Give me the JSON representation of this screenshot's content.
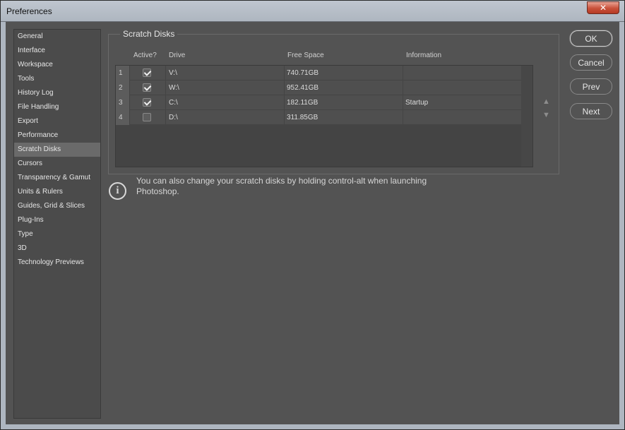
{
  "window": {
    "title": "Preferences",
    "close_label": "✕"
  },
  "sidebar": {
    "items": [
      {
        "label": "General"
      },
      {
        "label": "Interface"
      },
      {
        "label": "Workspace"
      },
      {
        "label": "Tools"
      },
      {
        "label": "History Log"
      },
      {
        "label": "File Handling"
      },
      {
        "label": "Export"
      },
      {
        "label": "Performance"
      },
      {
        "label": "Scratch Disks"
      },
      {
        "label": "Cursors"
      },
      {
        "label": "Transparency & Gamut"
      },
      {
        "label": "Units & Rulers"
      },
      {
        "label": "Guides, Grid & Slices"
      },
      {
        "label": "Plug-Ins"
      },
      {
        "label": "Type"
      },
      {
        "label": "3D"
      },
      {
        "label": "Technology Previews"
      }
    ],
    "selected": "Scratch Disks"
  },
  "scratch": {
    "group_title": "Scratch Disks",
    "columns": {
      "active": "Active?",
      "drive": "Drive",
      "free": "Free Space",
      "info": "Information"
    },
    "rows": [
      {
        "num": "1",
        "active": true,
        "drive": "V:\\",
        "free": "740.71GB",
        "info": ""
      },
      {
        "num": "2",
        "active": true,
        "drive": "W:\\",
        "free": "952.41GB",
        "info": ""
      },
      {
        "num": "3",
        "active": true,
        "drive": "C:\\",
        "free": "182.11GB",
        "info": "Startup"
      },
      {
        "num": "4",
        "active": false,
        "drive": "D:\\",
        "free": "311.85GB",
        "info": ""
      }
    ],
    "up_arrow": "▲",
    "down_arrow": "▼"
  },
  "info_message": {
    "icon": "info-icon",
    "glyph": "i",
    "text": "You can also change your scratch disks by holding control-alt when launching Photoshop."
  },
  "buttons": {
    "ok": "OK",
    "cancel": "Cancel",
    "prev": "Prev",
    "next": "Next"
  }
}
